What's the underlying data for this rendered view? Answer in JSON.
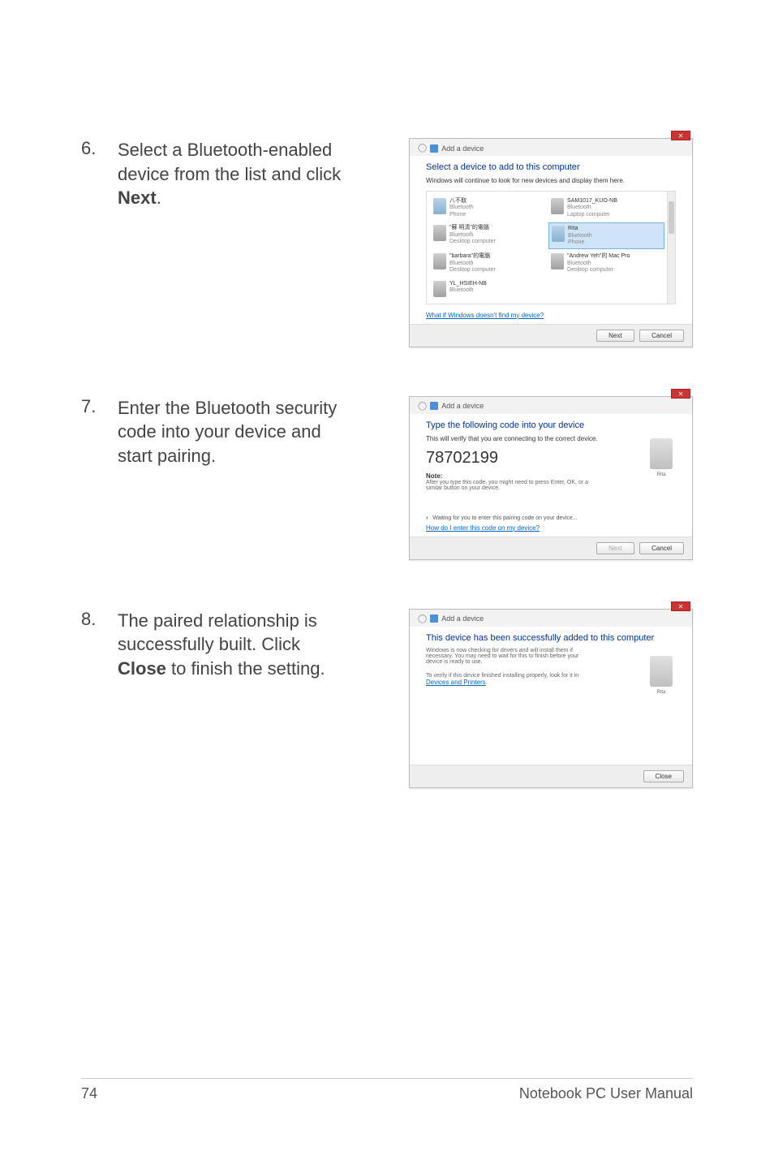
{
  "steps": {
    "s6": {
      "num": "6.",
      "text_pre": "Select a Bluetooth-enabled device from the list and click ",
      "text_bold": "Next",
      "text_post": "."
    },
    "s7": {
      "num": "7.",
      "text": "Enter the Bluetooth security code into your device and start pairing."
    },
    "s8": {
      "num": "8.",
      "text_pre": "The paired relationship is successfully built. Click ",
      "text_bold": "Close",
      "text_post": " to finish the setting."
    }
  },
  "dialog1": {
    "header": "Add a device",
    "title": "Select a device to add to this computer",
    "subtitle": "Windows will continue to look for new devices and display them here.",
    "link": "What if Windows doesn't find my device?",
    "next": "Next",
    "cancel": "Cancel",
    "devices": [
      {
        "name": "八不取",
        "line2": "Bluetooth",
        "line3": "Phone",
        "iconClass": "phone"
      },
      {
        "name": "SAM1017_KUO-NB",
        "line2": "Bluetooth",
        "line3": "Laptop computer",
        "iconClass": ""
      },
      {
        "name": "\"蘇 明清\"的電腦",
        "line2": "Bluetooth",
        "line3": "Desktop computer",
        "iconClass": ""
      },
      {
        "name": "Rita",
        "line2": "Bluetooth",
        "line3": "Phone",
        "iconClass": "phone",
        "selected": true
      },
      {
        "name": "\"barbara\"的電腦",
        "line2": "Bluetooth",
        "line3": "Desktop computer",
        "iconClass": ""
      },
      {
        "name": "\"Andrew Yeh\"的 Mac Pro",
        "line2": "Bluetooth",
        "line3": "Desktop computer",
        "iconClass": ""
      },
      {
        "name": "YL_HSIEH-NB",
        "line2": "Bluetooth",
        "line3": "",
        "iconClass": ""
      }
    ]
  },
  "dialog2": {
    "header": "Add a device",
    "title": "Type the following code into your device",
    "subtitle": "This will verify that you are connecting to the correct device.",
    "code": "78702199",
    "note_label": "Note:",
    "note_text": "After you type this code, you might need to press Enter, OK, or a similar button on your device.",
    "waiting": "Waiting for you to enter this pairing code on your device...",
    "link": "How do I enter this code on my device?",
    "device_label": "Rita",
    "next": "Next",
    "cancel": "Cancel"
  },
  "dialog3": {
    "header": "Add a device",
    "title": "This device has been successfully added to this computer",
    "body1": "Windows is now checking for drivers and will install them if necessary. You may need to wait for this to finish before your device is ready to use.",
    "body2_pre": "To verify if this device finished installing properly, look for it in ",
    "body2_link": "Devices and Printers",
    "device_label": "Rita",
    "close": "Close"
  },
  "footer": {
    "page": "74",
    "title": "Notebook PC User Manual"
  }
}
